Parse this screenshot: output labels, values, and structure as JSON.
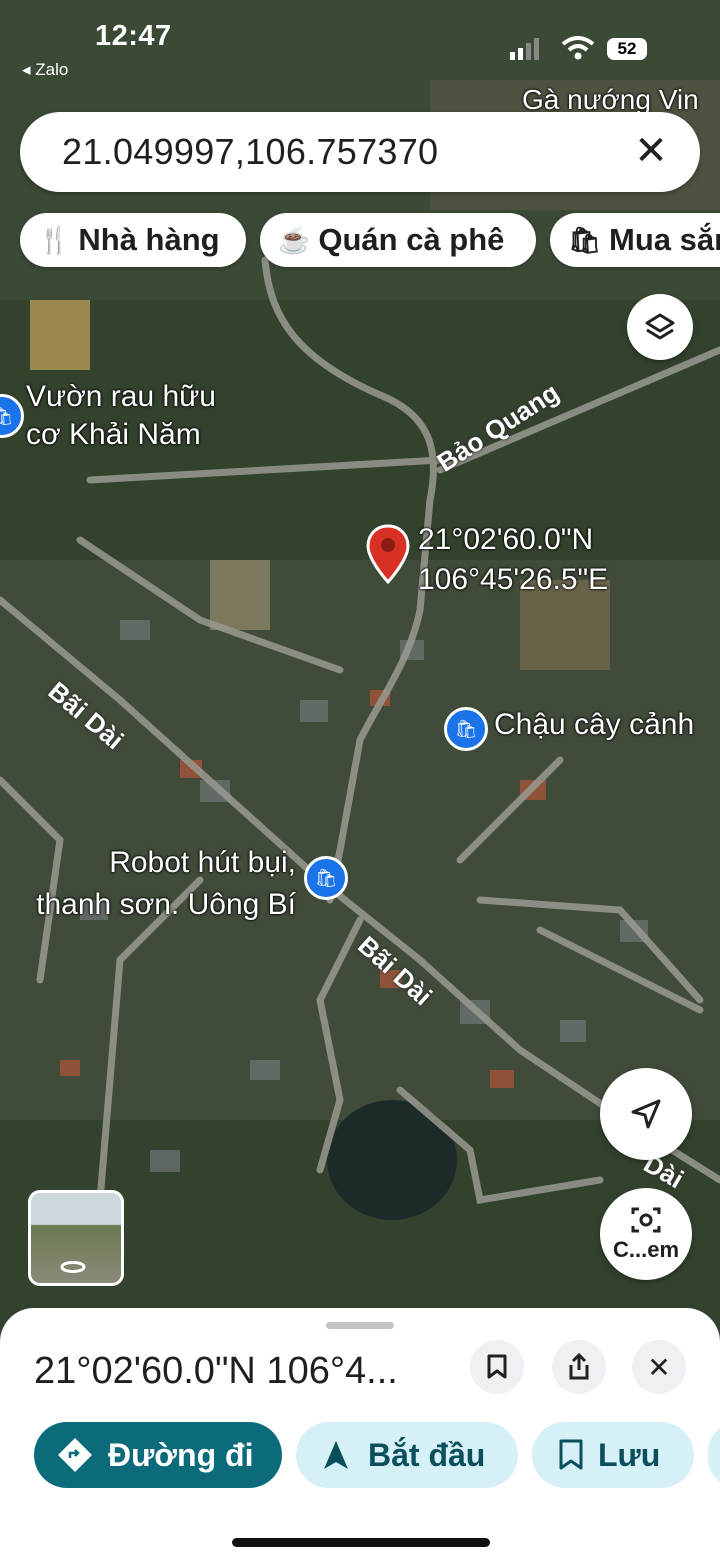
{
  "status": {
    "time": "12:47",
    "back_app": "◂ Zalo",
    "battery": "52"
  },
  "search": {
    "query": "21.049997,106.757370"
  },
  "chips": [
    {
      "icon": "restaurant-icon",
      "label": "Nhà hàng"
    },
    {
      "icon": "coffee-icon",
      "label": "Quán cà phê"
    },
    {
      "icon": "shopping-bag-icon",
      "label": "Mua sắm"
    }
  ],
  "map": {
    "pin_coords": [
      "21°02'60.0\"N",
      "106°45'26.5\"E"
    ],
    "places": [
      {
        "name_lines": [
          "Vườn rau hữu",
          "cơ Khải Năm"
        ]
      },
      {
        "name_lines": [
          "Chậu cây cảnh"
        ]
      },
      {
        "name_lines": [
          "Robot hút bụi,",
          "thanh sơn. Uông Bí"
        ]
      },
      {
        "name_lines": [
          "Gà nướng Vin"
        ]
      }
    ],
    "roads": [
      "Bảo Quang",
      "Bãi Dài",
      "Bãi Dài",
      "Dài"
    ],
    "camera_label": "C...em"
  },
  "sheet": {
    "title": "21°02'60.0\"N 106°4...",
    "directions": "Đường đi",
    "start": "Bắt đầu",
    "save": "Lưu"
  },
  "colors": {
    "accent_teal": "#0b6b7a",
    "light_teal": "#d5f0f6",
    "pin_red": "#d93025",
    "poi_blue": "#1a73e8"
  }
}
